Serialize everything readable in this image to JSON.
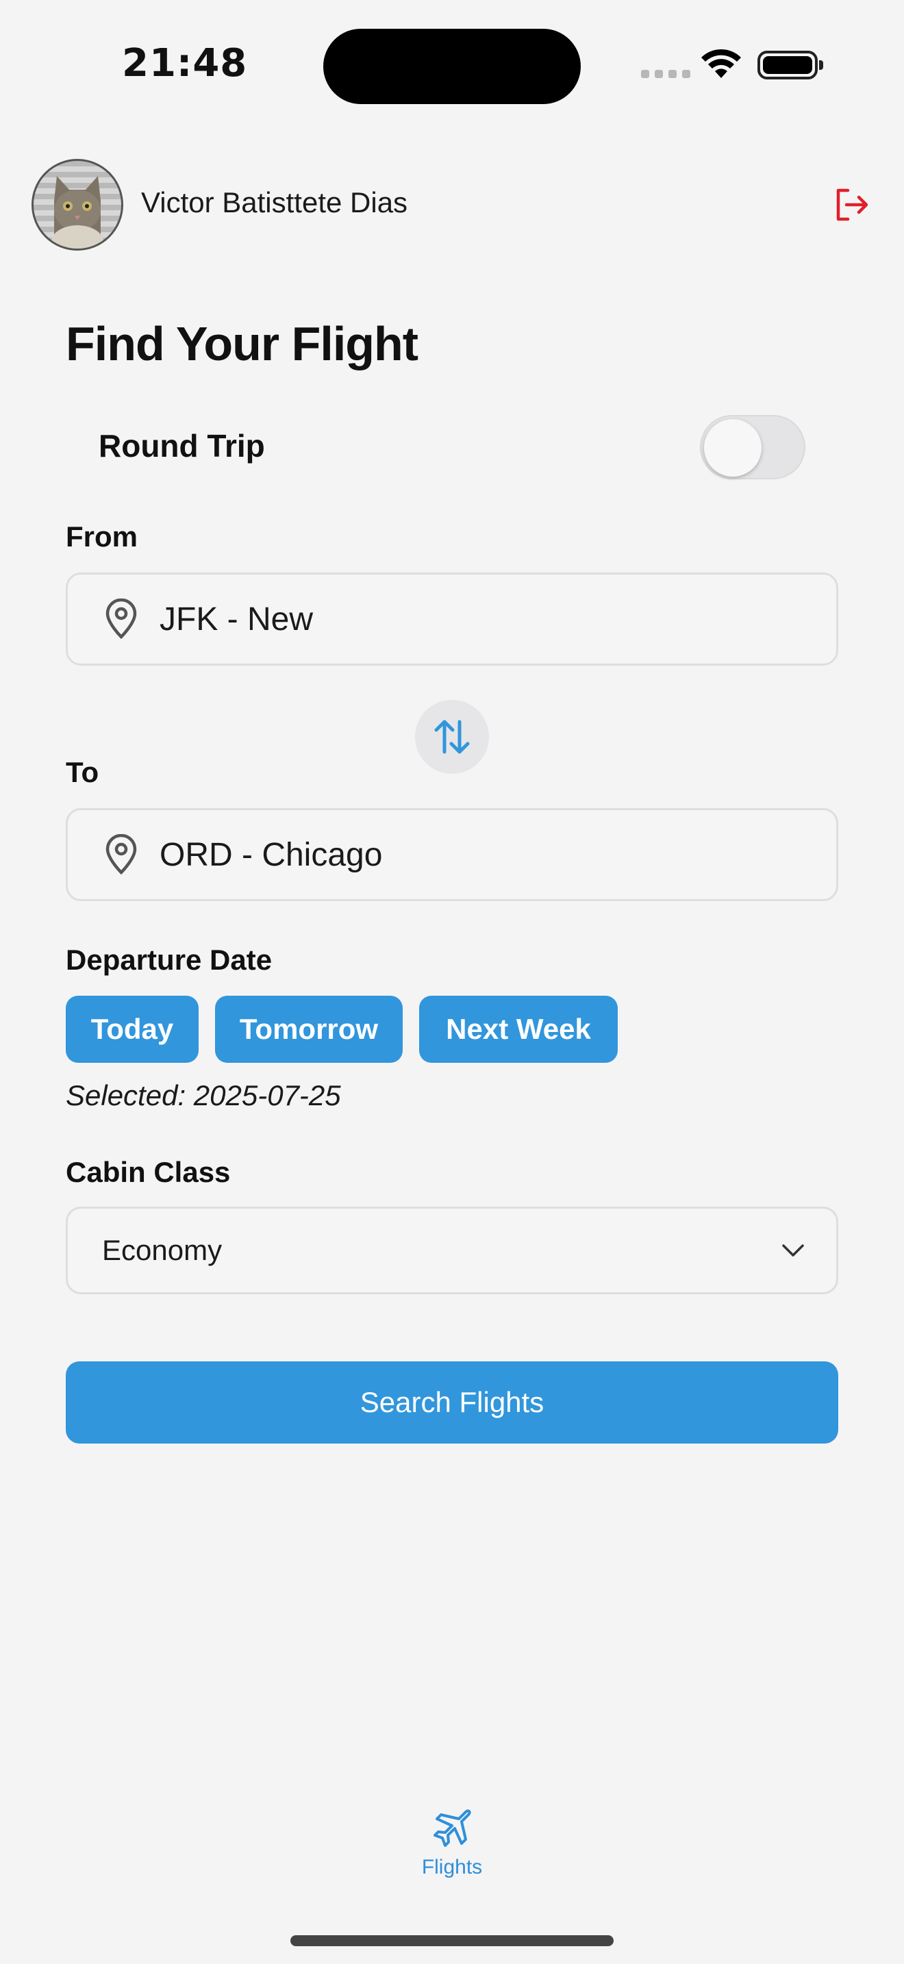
{
  "status_bar": {
    "time": "21:48"
  },
  "header": {
    "user_name": "Victor Batisttete Dias",
    "avatar": "cat-avatar",
    "logout_icon": "logout-icon"
  },
  "page": {
    "title": "Find Your Flight"
  },
  "round_trip": {
    "label": "Round Trip",
    "enabled": false
  },
  "from": {
    "label": "From",
    "value": "JFK - New",
    "icon": "map-pin-icon"
  },
  "swap": {
    "icon": "swap-arrows-icon"
  },
  "to": {
    "label": "To",
    "value": "ORD - Chicago",
    "icon": "map-pin-icon"
  },
  "departure": {
    "label": "Departure Date",
    "chips": [
      "Today",
      "Tomorrow",
      "Next Week"
    ],
    "selected_text": "Selected: 2025-07-25"
  },
  "cabin": {
    "label": "Cabin Class",
    "value": "Economy"
  },
  "search_button": {
    "label": "Search Flights"
  },
  "tab_bar": {
    "items": [
      {
        "label": "Flights",
        "icon": "airplane-icon",
        "active": true
      }
    ]
  },
  "colors": {
    "accent": "#3196dc",
    "logout": "#e0202a",
    "background": "#f4f4f5"
  }
}
